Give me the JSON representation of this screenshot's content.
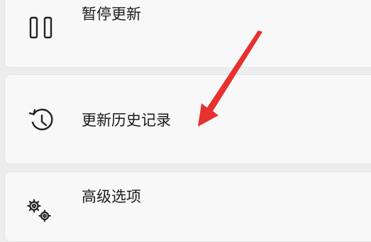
{
  "settings": {
    "items": [
      {
        "label": "暂停更新",
        "icon": "pause-icon"
      },
      {
        "label": "更新历史记录",
        "icon": "history-icon"
      },
      {
        "label": "高级选项",
        "icon": "gear-icon"
      }
    ]
  },
  "annotation": {
    "icon": "red-arrow",
    "color": "#e8312f"
  }
}
